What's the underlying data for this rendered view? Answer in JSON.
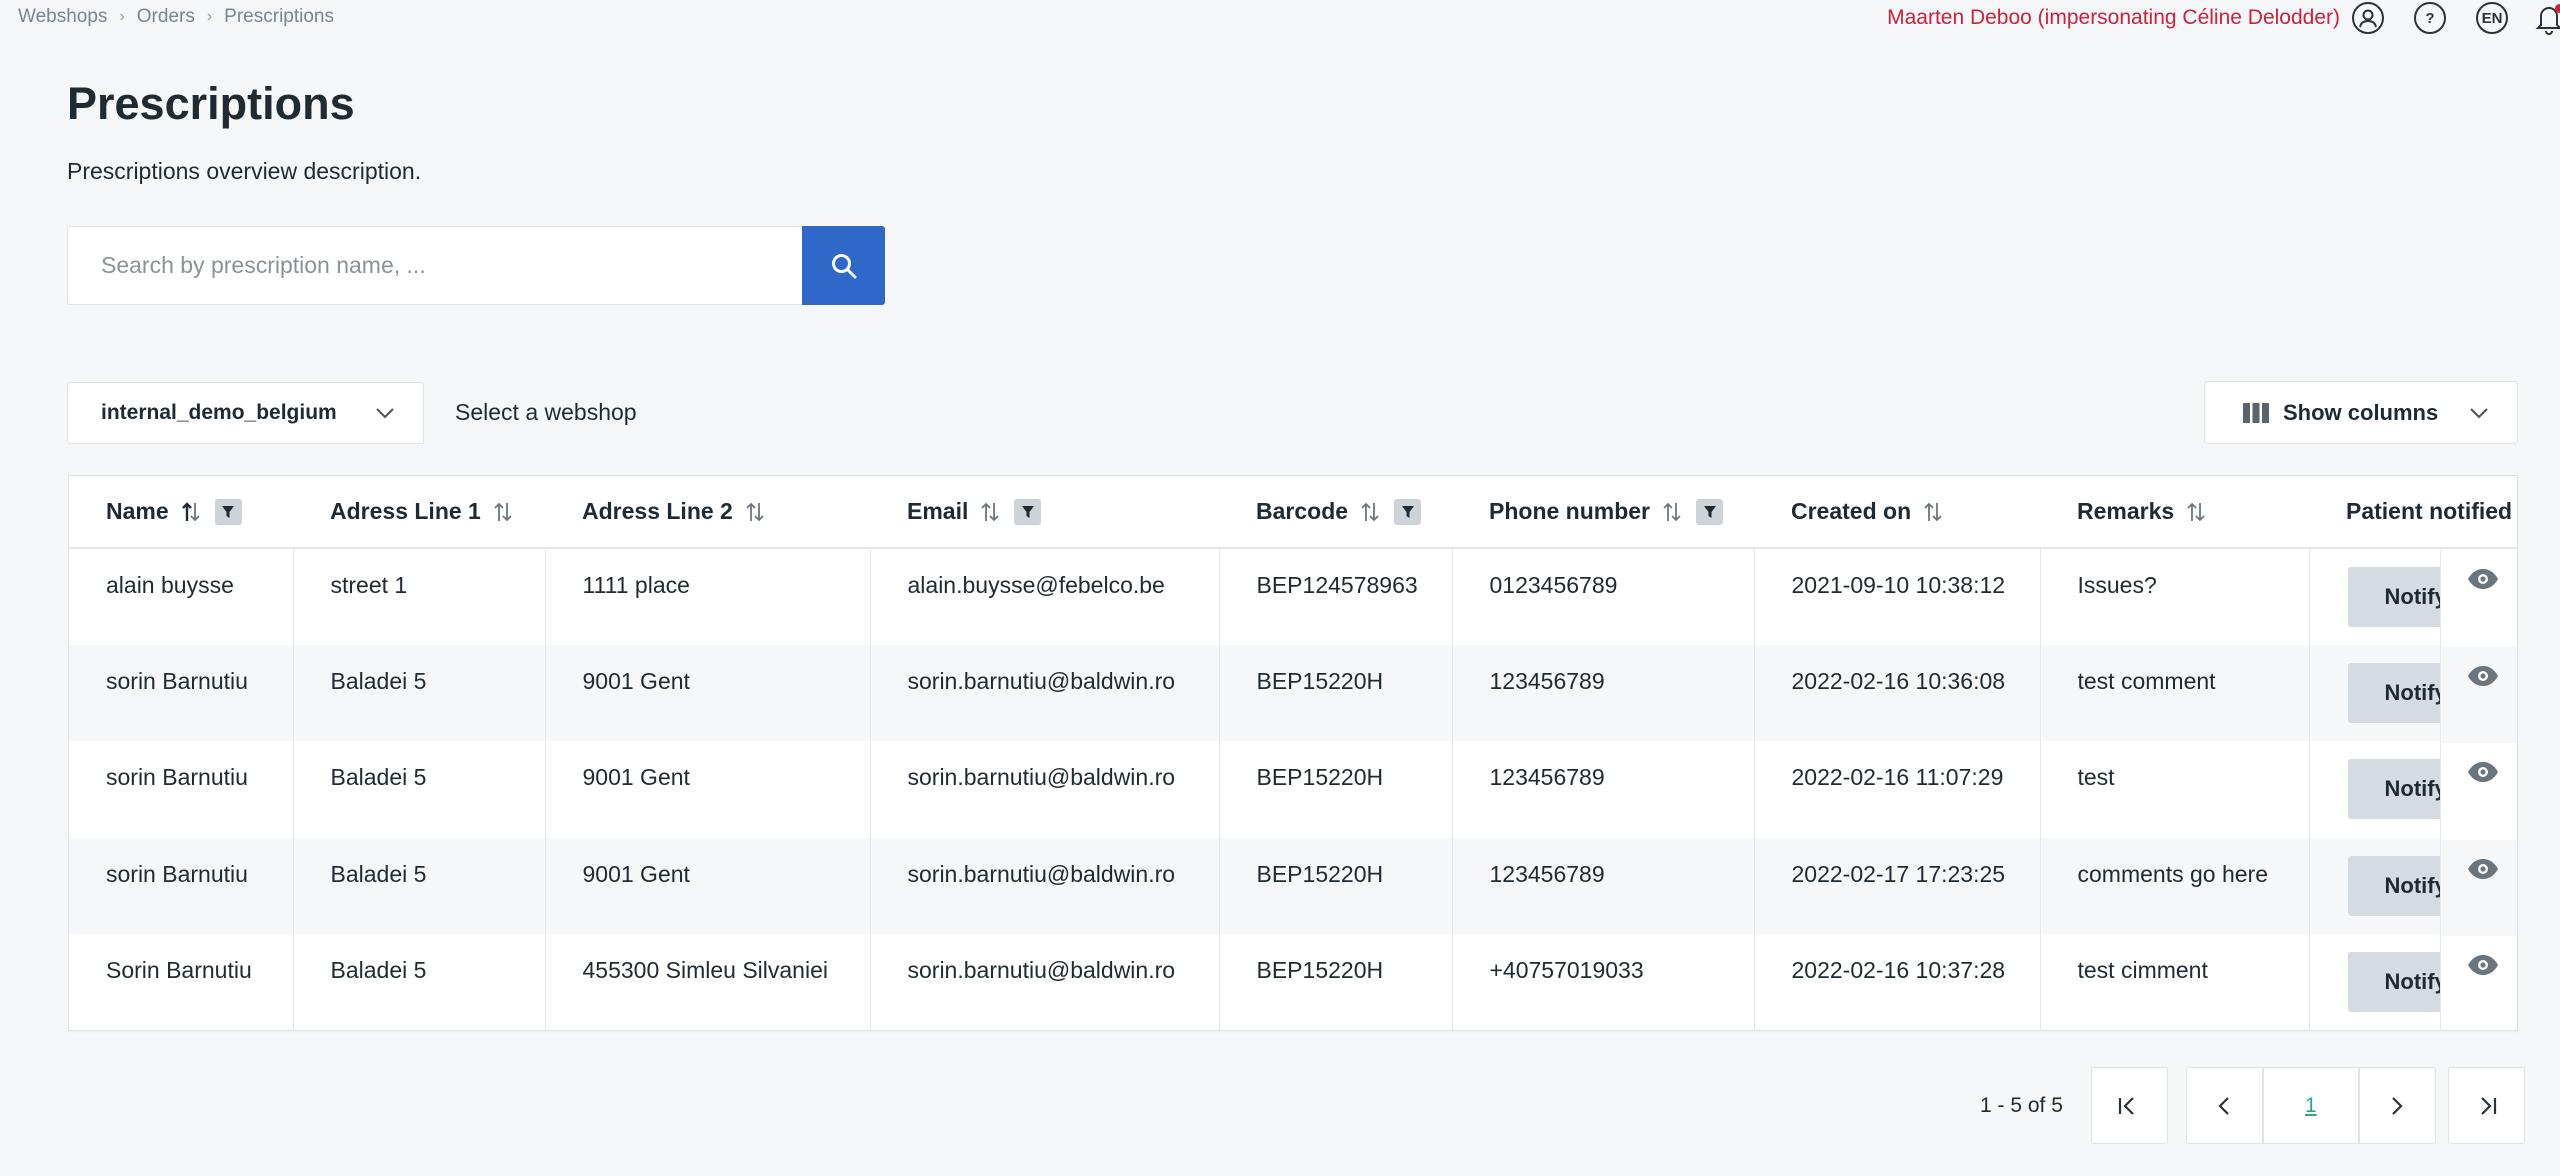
{
  "breadcrumb": [
    "Webshops",
    "Orders",
    "Prescriptions"
  ],
  "user": {
    "name": "Maarten Deboo (impersonating Céline Delodder)",
    "language": "EN",
    "help": "?"
  },
  "page": {
    "title": "Prescriptions",
    "description": "Prescriptions overview description."
  },
  "search": {
    "placeholder": "Search by prescription name, ..."
  },
  "webshop": {
    "selected": "internal_demo_belgium",
    "label": "Select a webshop"
  },
  "show_columns_label": "Show columns",
  "table": {
    "headers": [
      "Name",
      "Adress Line 1",
      "Adress Line 2",
      "Email",
      "Barcode",
      "Phone number",
      "Created on",
      "Remarks",
      "Patient notified"
    ],
    "notify_label": "Notify",
    "rows": [
      [
        "alain buysse",
        "street 1",
        "1111 place",
        "alain.buysse@febelco.be",
        "BEP124578963",
        "0123456789",
        "2021-09-10 10:38:12",
        "Issues?"
      ],
      [
        "sorin Barnutiu",
        "Baladei 5",
        "9001 Gent",
        "sorin.barnutiu@baldwin.ro",
        "BEP15220H",
        "123456789",
        "2022-02-16 10:36:08",
        "test comment"
      ],
      [
        "sorin Barnutiu",
        "Baladei 5",
        "9001 Gent",
        "sorin.barnutiu@baldwin.ro",
        "BEP15220H",
        "123456789",
        "2022-02-16 11:07:29",
        "test"
      ],
      [
        "sorin Barnutiu",
        "Baladei 5",
        "9001 Gent",
        "sorin.barnutiu@baldwin.ro",
        "BEP15220H",
        "123456789",
        "2022-02-17 17:23:25",
        "comments go here"
      ],
      [
        "Sorin Barnutiu",
        "Baladei 5",
        "455300 Simleu Silvaniei",
        "sorin.barnutiu@baldwin.ro",
        "BEP15220H",
        "+40757019033",
        "2022-02-16 10:37:28",
        "test cimment"
      ]
    ]
  },
  "pagination": {
    "info": "1 - 5 of 5",
    "current": "1"
  },
  "colors": {
    "accent": "#2f68c9",
    "user": "#d0203c",
    "page_link": "#2aa39a"
  }
}
